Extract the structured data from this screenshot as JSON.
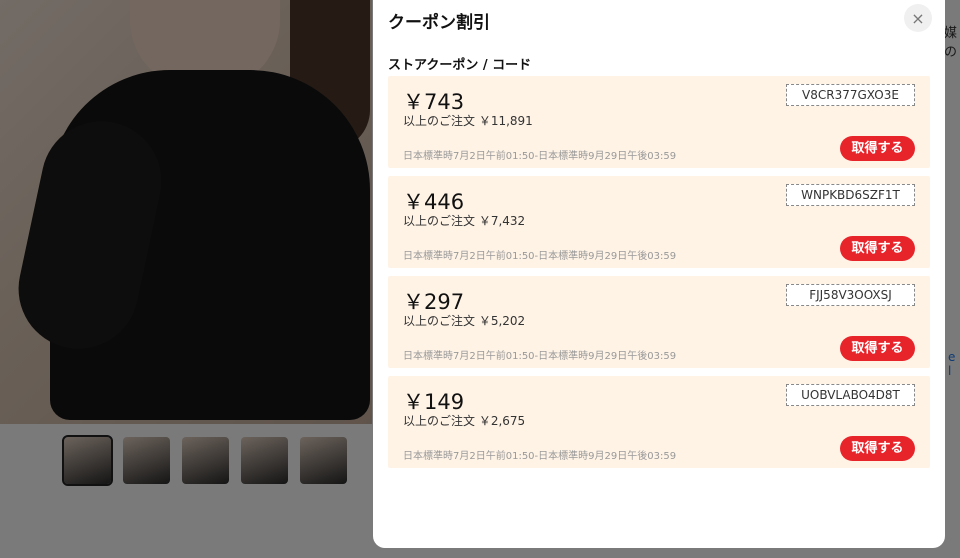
{
  "background": {
    "side_text": "媒の",
    "side_link": "e l",
    "thumbnails": [
      "thumb-1",
      "thumb-2",
      "thumb-3",
      "thumb-4",
      "thumb-5"
    ]
  },
  "modal": {
    "title": "クーポン割引",
    "close_icon": "×",
    "section_label": "ストアクーポン / コード",
    "coupons": [
      {
        "amount": "￥743",
        "condition": "以上のご注文 ￥11,891",
        "code": "V8CR377GXO3E",
        "validity": "日本標準時7月2日午前01:50-日本標準時9月29日午後03:59",
        "button": "取得する"
      },
      {
        "amount": "￥446",
        "condition": "以上のご注文 ￥7,432",
        "code": "WNPKBD6SZF1T",
        "validity": "日本標準時7月2日午前01:50-日本標準時9月29日午後03:59",
        "button": "取得する"
      },
      {
        "amount": "￥297",
        "condition": "以上のご注文 ￥5,202",
        "code": "FJJ58V3OOXSJ",
        "validity": "日本標準時7月2日午前01:50-日本標準時9月29日午後03:59",
        "button": "取得する"
      },
      {
        "amount": "￥149",
        "condition": "以上のご注文 ￥2,675",
        "code": "UOBVLABO4D8T",
        "validity": "日本標準時7月2日午前01:50-日本標準時9月29日午後03:59",
        "button": "取得する"
      }
    ]
  },
  "colors": {
    "accent": "#e8242b",
    "coupon_bg": "#fff3e6"
  }
}
